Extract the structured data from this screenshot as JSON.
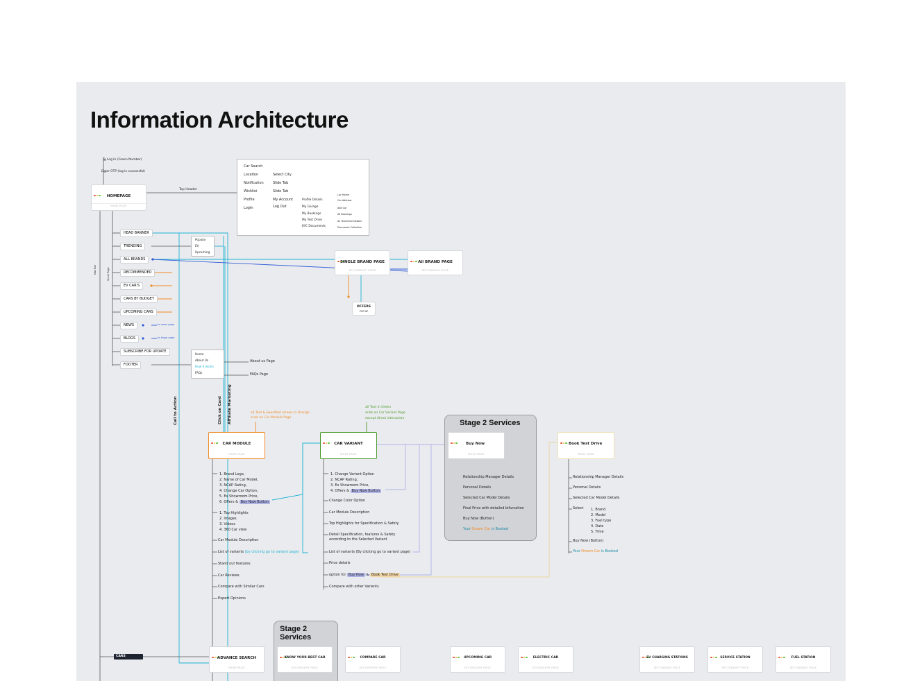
{
  "title": "Information Architecture",
  "colors": {
    "cyan": "#1fb3d4",
    "orange": "#f08a24",
    "blue": "#2f5bd8",
    "lavender": "#aeb3e6",
    "green": "#4a9a2a",
    "dark": "#1e2430",
    "yellow": "#e8d49a"
  },
  "icons": {
    "window_dots": "window-dots-icon",
    "arrow": "arrow-icon"
  },
  "top_notes": {
    "login_note": "To Log In (Green Number)",
    "otp_note": "Enter OTP (log in successful)"
  },
  "homepage": {
    "title": "HOMEPAGE",
    "sub": "MAIN PAGE"
  },
  "top_header_label": "Top Header",
  "header_menu": {
    "items": [
      "Car Search",
      "Location",
      "Notification",
      "Wishlist",
      "Profile",
      "Login"
    ],
    "sub1": [
      "Select City",
      "Slide Tab",
      "Slide Tab",
      "My Account",
      "Log Out"
    ],
    "sub2": [
      "Profile Details",
      "My Garage",
      "My Bookings",
      "My Test Drive",
      "KYC Documents"
    ],
    "sub3": [
      "Loc Home",
      "Car Address",
      "Add Car",
      "All Bookings",
      "All Test Drive Details",
      "Document Collection"
    ]
  },
  "sections": [
    "HEAD BANNER",
    "TRENDING",
    "ALL BRANDS",
    "RECOMMENDED",
    "EV CAR'S",
    "CARS BY BUDGET",
    "UPCOMING CARS",
    "NEWS",
    "BLOGS",
    "SUBSCRIBE FOR UPDATE",
    "FOOTER"
  ],
  "news_link": "to news page",
  "blogs_link": "to blogs page",
  "vertical_labels": {
    "nav_bar": "Nav Bar",
    "scroll_page": "Scroll Page",
    "call_to_action": "Call to Action",
    "click_on_card": "Click on Card",
    "affiliate": "Affiliate Marketing"
  },
  "trending_options": [
    "Popular",
    "EV",
    "Upcoming"
  ],
  "footer_links": [
    "Home",
    "About Us",
    "How it works",
    "FAQs"
  ],
  "footer_targets": [
    "About us Page",
    "FAQs Page"
  ],
  "single_brand": {
    "title": "SINGLE BRAND PAGE",
    "sub": "SECONDARY PAGE"
  },
  "all_brand": {
    "title": "All BRAND PAGE",
    "sub": "SECONDARY PAGE"
  },
  "offers": {
    "title": "OFFERS",
    "sub": "POP-UP"
  },
  "orange_note": [
    "all Text & Specified arrows in Orange",
    "ends on Car Module Page"
  ],
  "green_note": [
    "all Text in Green",
    "ends on Car Variant Page",
    "except direct interaction"
  ],
  "car_module": {
    "title": "CAR MODULE",
    "sub": "MAIN PAGE",
    "list1": [
      "1. Brand Logo,",
      "2. Name of Car Model,",
      "3. NCAP Rating,",
      "4. Change Car Option,",
      "5. Ex Showroom Price,",
      "6. Offers & "
    ],
    "buy_now": "Buy Now Button",
    "list2": [
      "1. Top Highlights",
      "2. Images",
      "3. Videos",
      "4. 360 Car view"
    ],
    "items": [
      "Car Module Description",
      "List of variants ",
      "Stand out features",
      "Car Reviews",
      "Compare with Similar Cars",
      "Expert Opinions"
    ],
    "variant_hint": "(by clicking go to variant page)"
  },
  "car_variant": {
    "title": "CAR VARIANT",
    "sub": "MAIN PAGE",
    "list1": [
      "1. Change Variant Option",
      "2. NCAP Rating,",
      "3. Ex Showroom Price,",
      "4. Offers & "
    ],
    "buy_now": "Buy Now Button",
    "items": [
      "Change Color Option",
      "Car Module Description",
      "Top Highlights for Specification & Safety",
      "Detail Specification, features & Safety",
      "according to the Selected Variant",
      "List of variants (By clicking go to variant page)",
      "Price details",
      "option for ",
      "Compare with other Variants"
    ],
    "opt_buy": "Buy Now",
    "opt_and": " & ",
    "opt_test": "Book Test Drive"
  },
  "stage2_top": {
    "title": "Stage 2 Services"
  },
  "buy_now_page": {
    "title": "Buy Now",
    "sub": "MAIN PAGE",
    "items": [
      "Relationship Manager Details",
      "Personal Details",
      "Selected Car Model Details",
      "Final Price with detailed bifurcation",
      "Buy Now (Button)"
    ],
    "booked_pre": "Your ",
    "booked_dream": "Dream Car",
    "booked_post": " is Booked"
  },
  "test_drive": {
    "title": "Book Test Drive",
    "sub": "MAIN PAGE",
    "items": [
      "Relationship Manager Details",
      "Personal Details",
      "Selected Car Model Details",
      "Select"
    ],
    "select_list": [
      "1. Brand",
      "2. Model",
      "3. Fuel type",
      "4. Date",
      "5. Time"
    ],
    "button": "Buy Now (Button)",
    "booked_pre": "Your ",
    "booked_dream": "Dream Car",
    "booked_post": " is Booked"
  },
  "cars_tag": "CARS",
  "stage2_bottom": {
    "title1": "Stage 2",
    "title2": "Services"
  },
  "bottom_pages": [
    {
      "title": "ADVANCE SEARCH",
      "sub": "MAIN PAGE"
    },
    {
      "title": "KNOW YOUR BEST CAR",
      "sub": "SECONDARY PAGE"
    },
    {
      "title": "COMPARE CAR",
      "sub": "SECONDARY PAGE"
    },
    {
      "title": "UPCOMING CAR",
      "sub": "SECONDARY PAGE"
    },
    {
      "title": "ELECTRIC CAR",
      "sub": "SECONDARY PAGE"
    },
    {
      "title": "EV CHARGING STATIONS",
      "sub": "SECONDARY PAGE"
    },
    {
      "title": "SERVICE STATION",
      "sub": "SECONDARY PAGE"
    },
    {
      "title": "FUEL STATION",
      "sub": "SECONDARY PAGE"
    }
  ]
}
